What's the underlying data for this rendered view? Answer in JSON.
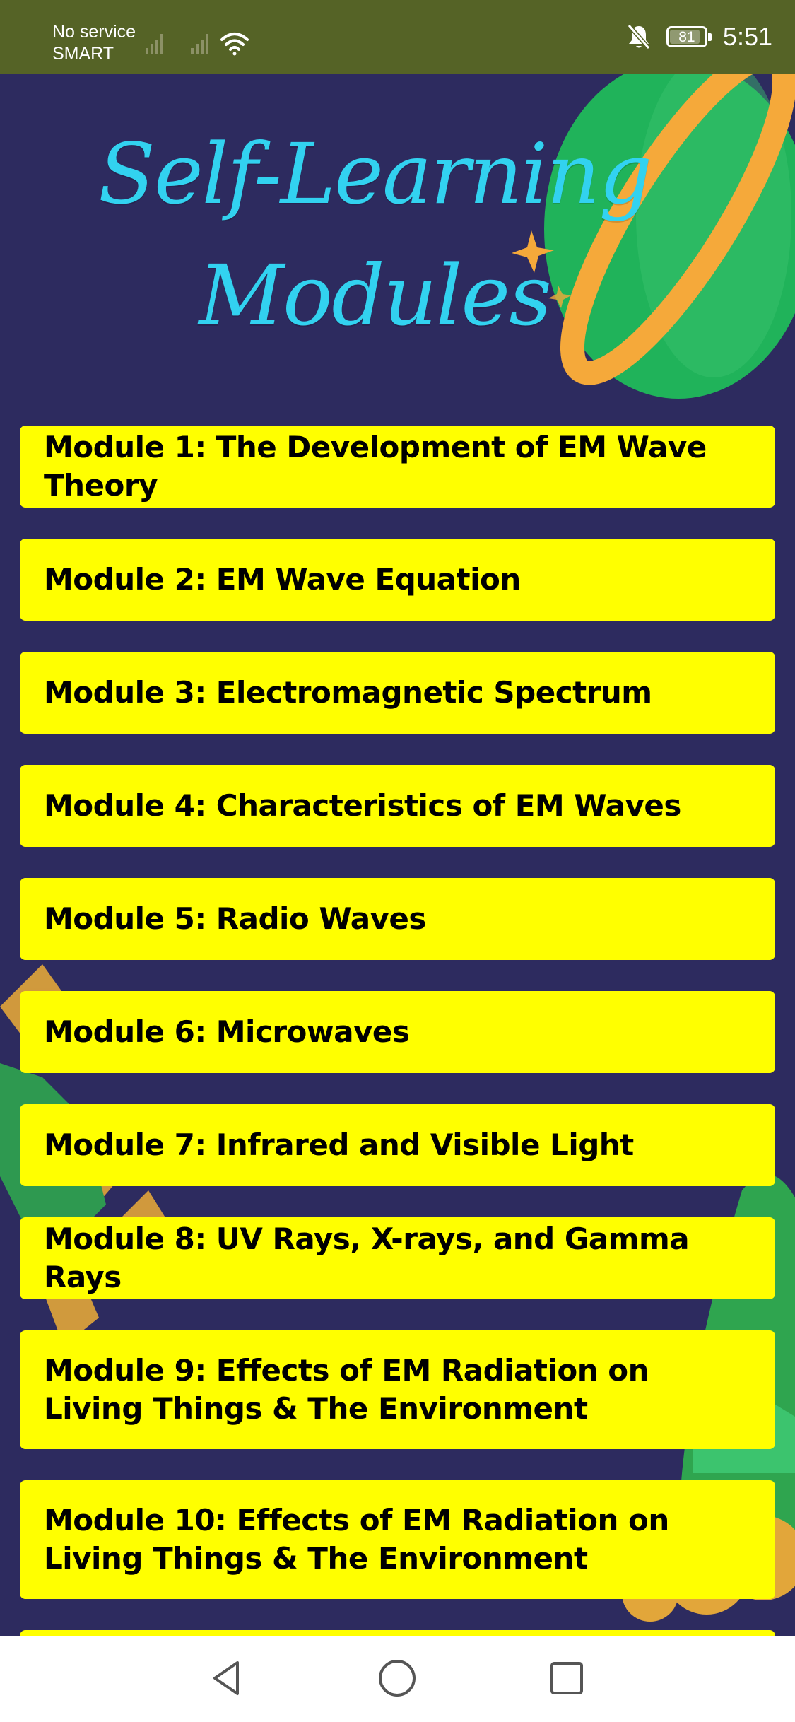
{
  "status_bar": {
    "carrier_line1": "No service",
    "carrier_line2": "SMART",
    "battery_level": "81",
    "time": "5:51",
    "icons": [
      "signal-bars-icon",
      "signal-bars-icon",
      "wifi-icon",
      "bell-off-icon",
      "battery-icon"
    ]
  },
  "header": {
    "title": "Self-Learning Modules"
  },
  "modules": [
    {
      "label": "Module 1: The Development of EM Wave Theory"
    },
    {
      "label": "Module 2: EM Wave Equation"
    },
    {
      "label": "Module 3: Electromagnetic Spectrum"
    },
    {
      "label": "Module 4: Characteristics of EM Waves"
    },
    {
      "label": "Module 5: Radio Waves"
    },
    {
      "label": "Module 6: Microwaves"
    },
    {
      "label": "Module 7: Infrared and Visible Light"
    },
    {
      "label": "Module 8: UV Rays, X-rays, and Gamma Rays"
    },
    {
      "label": "Module 9: Effects of EM Radiation on Living Things & The Environment"
    },
    {
      "label": "Module 10: Effects of EM Radiation on Living Things & The Environment"
    }
  ],
  "nav_bar": {
    "icons": [
      "back-triangle-icon",
      "home-circle-icon",
      "recents-square-icon"
    ]
  },
  "colors": {
    "status_bar_bg": "#556326",
    "page_bg": "#2d2b5f",
    "title_color": "#32d2f0",
    "button_bg": "#ffff00",
    "button_text": "#000000",
    "planet_green": "#20b35a",
    "planet_ring": "#f5a93a"
  }
}
